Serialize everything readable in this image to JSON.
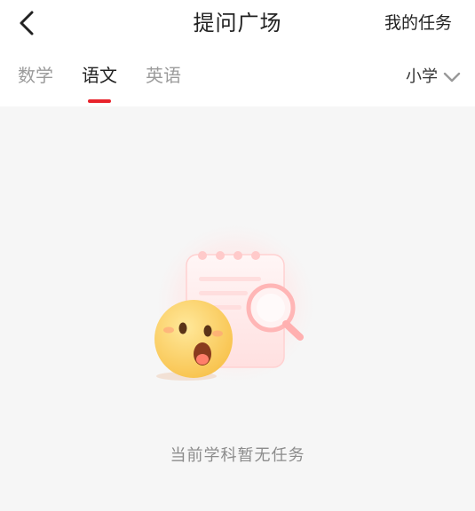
{
  "header": {
    "title": "提问广场",
    "my_tasks_label": "我的任务"
  },
  "tabs": [
    {
      "label": "数学",
      "active": false
    },
    {
      "label": "语文",
      "active": true
    },
    {
      "label": "英语",
      "active": false
    }
  ],
  "grade_filter": {
    "selected": "小学"
  },
  "empty_state": {
    "message": "当前学科暂无任务"
  },
  "colors": {
    "accent": "#e8232c",
    "background": "#f6f6f6"
  }
}
